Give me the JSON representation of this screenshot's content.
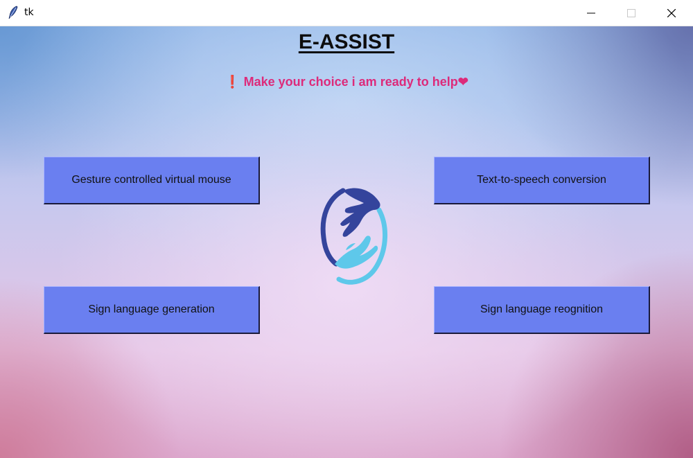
{
  "window": {
    "title": "tk",
    "icon": "tk-feather-icon",
    "controls": [
      "minimize-icon",
      "maximize-icon",
      "close-icon"
    ]
  },
  "app": {
    "heading": "E-ASSIST",
    "subtitle_prefix_icon": "❗",
    "subtitle_text": " Make your choice i am ready to help",
    "subtitle_suffix_icon": "❤",
    "logo": "hands-care-logo-icon"
  },
  "buttons": {
    "gesture_mouse": "Gesture controlled virtual mouse",
    "text_to_speech": "Text-to-speech conversion",
    "sign_generation": "Sign language generation",
    "sign_recognition": "Sign language reognition"
  },
  "colors": {
    "button_bg": "#6a7ff0",
    "subtitle": "#dd2a7a",
    "logo_dark": "#3a4aa8",
    "logo_light": "#5ec8ea"
  }
}
